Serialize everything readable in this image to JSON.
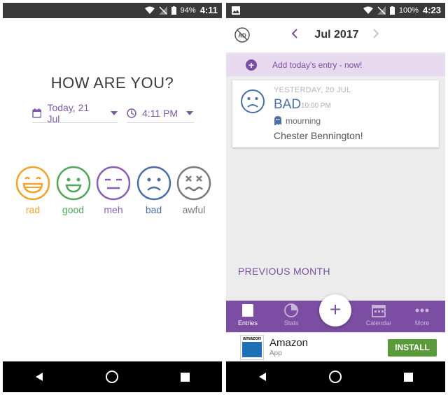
{
  "left_screen": {
    "status": {
      "battery_pct": "94%",
      "time": "4:11"
    },
    "title": "HOW ARE YOU?",
    "date_label": "Today, 21 Jul",
    "time_label": "4:11 PM",
    "moods": [
      {
        "label": "rad",
        "color": "#f0a22a"
      },
      {
        "label": "good",
        "color": "#4fa65b"
      },
      {
        "label": "meh",
        "color": "#8a5fb3"
      },
      {
        "label": "bad",
        "color": "#4a6ea6"
      },
      {
        "label": "awful",
        "color": "#7a7a7a"
      }
    ]
  },
  "right_screen": {
    "status": {
      "battery_pct": "100%",
      "time": "4:23"
    },
    "month_title": "Jul 2017",
    "add_entry": "Add today's entry - now!",
    "entry": {
      "date": "YESTERDAY, 20 JUL",
      "mood": "BAD",
      "time": "10:00 PM",
      "tag": "mourning",
      "note": "Chester Bennington!"
    },
    "previous_month": "PREVIOUS MONTH",
    "bottom_nav": {
      "entries": "Entries",
      "stats": "Stats",
      "calendar": "Calendar",
      "more": "More",
      "fab": "+"
    },
    "ad": {
      "logo_text": "amazon",
      "title": "Amazon",
      "subtitle": "App",
      "button": "INSTALL"
    }
  },
  "colors": {
    "accent": "#7b4ea3",
    "banner": "#e7d9ee",
    "install": "#5b9a3b"
  }
}
